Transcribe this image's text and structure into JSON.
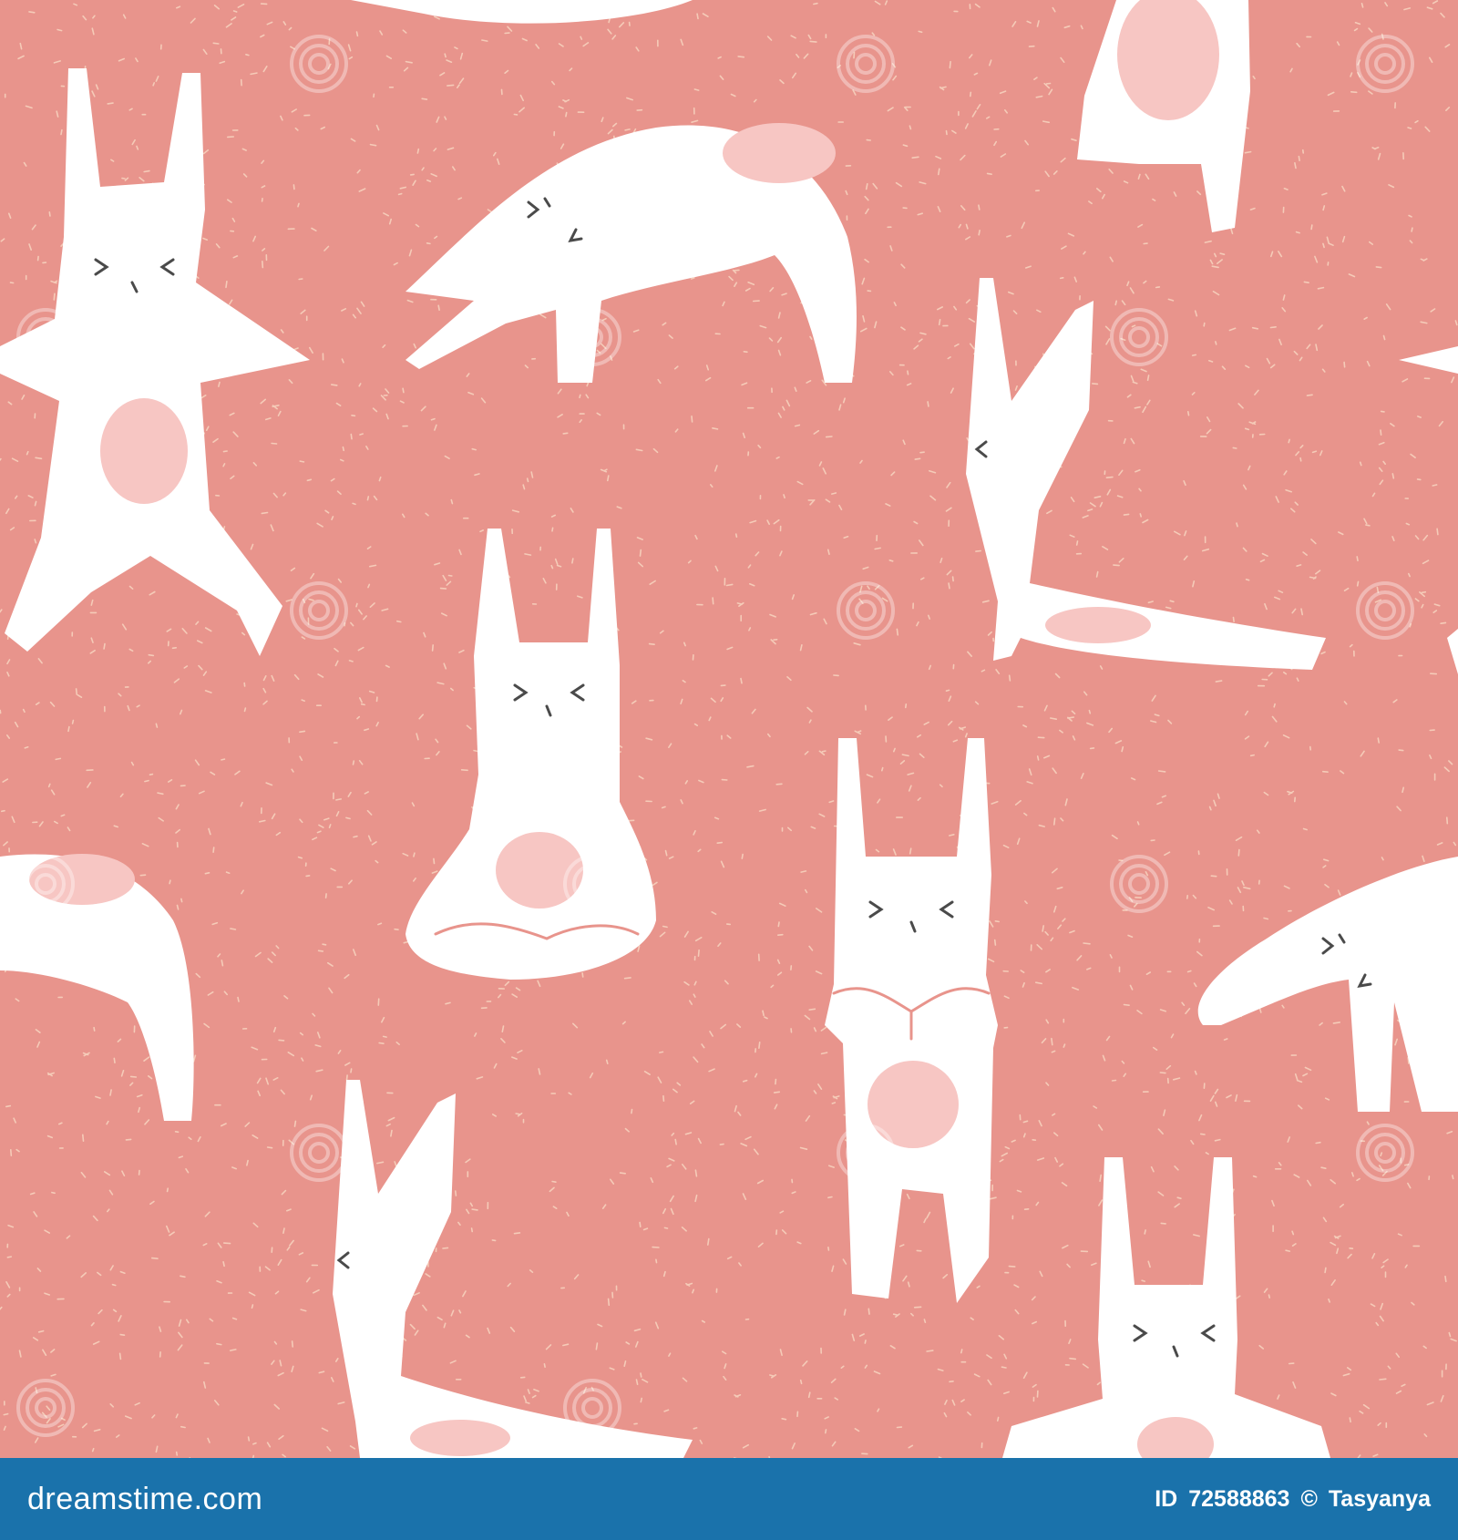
{
  "artwork": {
    "subject": "seamless pattern of white rabbits in yoga poses",
    "colors": {
      "background": "#e8948c",
      "speckle": "#f5cbb8",
      "rabbit": "#ffffff",
      "belly": "#f7c6c3",
      "face": "#4a4a4a"
    },
    "poses": [
      "star-pose",
      "downward-dog",
      "side-bend",
      "lotus-meditation",
      "prayer-standing",
      "warrior-lunge"
    ]
  },
  "footer": {
    "colors": {
      "background": "#1a72ab",
      "text": "#ffffff"
    },
    "brand": "dreamstime.com",
    "id_label": "ID",
    "image_id": "72588863",
    "copyright": "©",
    "author": "Tasyanya"
  },
  "watermark": {
    "icon": "spiral-watermark-icon"
  }
}
